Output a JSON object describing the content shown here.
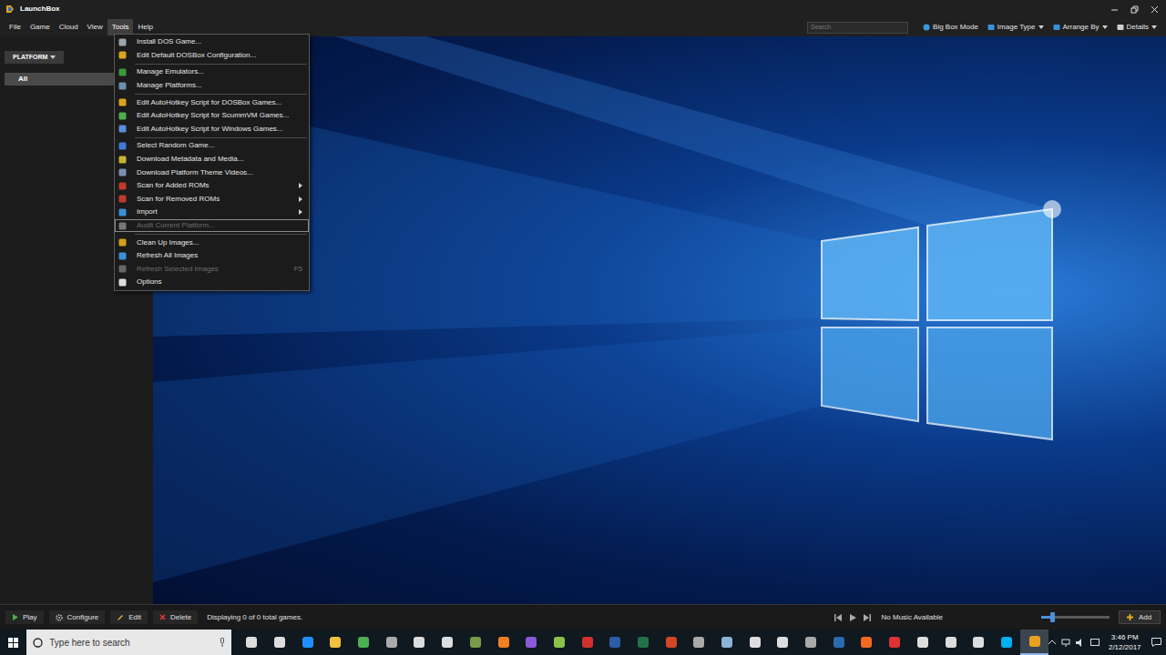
{
  "window": {
    "title": "LaunchBox"
  },
  "menubar": [
    {
      "label": "File",
      "selected": false
    },
    {
      "label": "Game",
      "selected": false
    },
    {
      "label": "Cloud",
      "selected": false
    },
    {
      "label": "View",
      "selected": false
    },
    {
      "label": "Tools",
      "selected": true
    },
    {
      "label": "Help",
      "selected": false
    }
  ],
  "toolbar": {
    "search_placeholder": "Search",
    "buttons": [
      {
        "label": "Big Box Mode",
        "dropdown": false
      },
      {
        "label": "Image Type",
        "dropdown": true
      },
      {
        "label": "Arrange By",
        "dropdown": true
      },
      {
        "label": "Details",
        "dropdown": true
      }
    ]
  },
  "sidebar": {
    "filter": {
      "label": "PLATFORM",
      "dropdown": true
    },
    "items": [
      {
        "label": "All",
        "selected": true
      }
    ]
  },
  "open_menu": {
    "sections": [
      [
        {
          "label": "Install DOS Game...",
          "disabled": false,
          "submenu": false,
          "hovered": false,
          "shortcut": "",
          "color": "#9aa4ad"
        },
        {
          "label": "Edit Default DOSBox Configuration...",
          "disabled": false,
          "submenu": false,
          "hovered": false,
          "shortcut": "",
          "color": "#d9a520"
        }
      ],
      [
        {
          "label": "Manage Emulators...",
          "disabled": false,
          "submenu": false,
          "hovered": false,
          "shortcut": "",
          "color": "#3a9a3a"
        },
        {
          "label": "Manage Platforms...",
          "disabled": false,
          "submenu": false,
          "hovered": false,
          "shortcut": "",
          "color": "#6d8fb0"
        }
      ],
      [
        {
          "label": "Edit AutoHotkey Script for DOSBox Games...",
          "disabled": false,
          "submenu": false,
          "hovered": false,
          "shortcut": "",
          "color": "#d9a520"
        },
        {
          "label": "Edit AutoHotkey Script for ScummVM Games...",
          "disabled": false,
          "submenu": false,
          "hovered": false,
          "shortcut": "",
          "color": "#4caf50"
        },
        {
          "label": "Edit AutoHotkey Script for Windows Games...",
          "disabled": false,
          "submenu": false,
          "hovered": false,
          "shortcut": "",
          "color": "#5b8dd9"
        }
      ],
      [
        {
          "label": "Select Random Game...",
          "disabled": false,
          "submenu": false,
          "hovered": false,
          "shortcut": "",
          "color": "#3d7bd6"
        },
        {
          "label": "Download Metadata and Media...",
          "disabled": false,
          "submenu": false,
          "hovered": false,
          "shortcut": "",
          "color": "#c8b430"
        },
        {
          "label": "Download Platform Theme Videos...",
          "disabled": false,
          "submenu": false,
          "hovered": false,
          "shortcut": "",
          "color": "#7a8fb0"
        },
        {
          "label": "Scan for Added ROMs",
          "disabled": false,
          "submenu": true,
          "hovered": false,
          "shortcut": "",
          "color": "#c0392b"
        },
        {
          "label": "Scan for Removed ROMs",
          "disabled": false,
          "submenu": true,
          "hovered": false,
          "shortcut": "",
          "color": "#c0392b"
        },
        {
          "label": "Import",
          "disabled": false,
          "submenu": true,
          "hovered": false,
          "shortcut": "",
          "color": "#3a8fd9"
        },
        {
          "label": "Audit Current Platform...",
          "disabled": true,
          "submenu": false,
          "hovered": true,
          "shortcut": "",
          "color": "#777777"
        }
      ],
      [
        {
          "label": "Clean Up Images...",
          "disabled": false,
          "submenu": false,
          "hovered": false,
          "shortcut": "",
          "color": "#d4a017"
        },
        {
          "label": "Refresh All Images",
          "disabled": false,
          "submenu": false,
          "hovered": false,
          "shortcut": "",
          "color": "#3a8fd9"
        },
        {
          "label": "Refresh Selected Images",
          "disabled": true,
          "submenu": false,
          "hovered": false,
          "shortcut": "F5",
          "color": "#666666"
        },
        {
          "label": "Options",
          "disabled": false,
          "submenu": false,
          "hovered": false,
          "shortcut": "",
          "color": "#dddddd"
        }
      ]
    ]
  },
  "bottom_bar": {
    "buttons": [
      "Play",
      "Configure",
      "Edit",
      "Delete"
    ],
    "status": "Displaying 0 of 0 total games.",
    "music": "No Music Available",
    "volume": {
      "level": 0.16
    },
    "add_button": "Add"
  },
  "taskbar": {
    "search_placeholder": "Type here to search",
    "time": "3:46 PM",
    "date": "2/12/2017",
    "apps": [
      {
        "color": "#dddddd",
        "active": false
      },
      {
        "color": "#dddddd",
        "active": false
      },
      {
        "color": "#1e90ff",
        "active": false
      },
      {
        "color": "#f0c040",
        "active": false
      },
      {
        "color": "#4caf50",
        "active": false
      },
      {
        "color": "#aaaaaa",
        "active": false
      },
      {
        "color": "#dddddd",
        "active": false
      },
      {
        "color": "#dddddd",
        "active": false
      },
      {
        "color": "#7a9a4a",
        "active": false
      },
      {
        "color": "#f08020",
        "active": false
      },
      {
        "color": "#8a5ad9",
        "active": false
      },
      {
        "color": "#8bc34a",
        "active": false
      },
      {
        "color": "#d32f2f",
        "active": false
      },
      {
        "color": "#2b5ca8",
        "active": false
      },
      {
        "color": "#217346",
        "active": false
      },
      {
        "color": "#d24726",
        "active": false
      },
      {
        "color": "#aaaaaa",
        "active": false
      },
      {
        "color": "#8ab4d8",
        "active": false
      },
      {
        "color": "#dddddd",
        "active": false
      },
      {
        "color": "#dddddd",
        "active": false
      },
      {
        "color": "#aaaaaa",
        "active": false
      },
      {
        "color": "#2a6ab0",
        "active": false
      },
      {
        "color": "#f06a20",
        "active": false
      },
      {
        "color": "#dd3333",
        "active": false
      },
      {
        "color": "#dddddd",
        "active": false
      },
      {
        "color": "#dddddd",
        "active": false
      },
      {
        "color": "#dddddd",
        "active": false
      },
      {
        "color": "#00aff0",
        "active": false
      },
      {
        "color": "#e8a020",
        "active": true
      }
    ]
  }
}
